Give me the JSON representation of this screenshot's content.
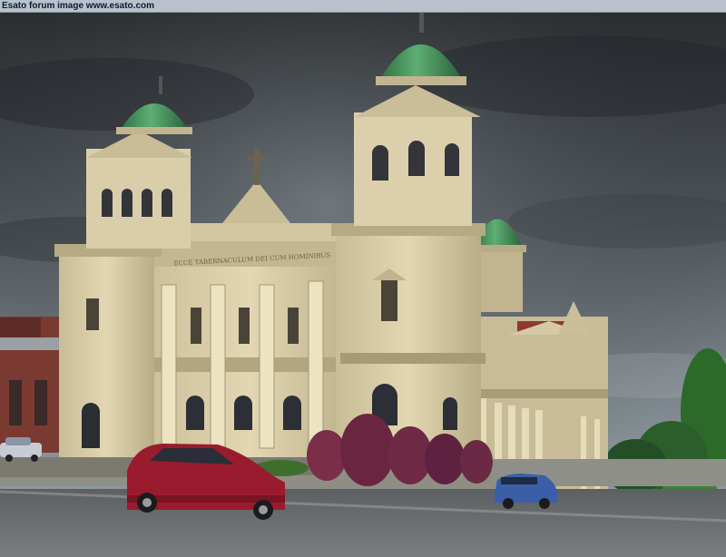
{
  "banner": {
    "text": "Esato forum image www.esato.com"
  },
  "scene": {
    "subject": "cathedral-photo",
    "frieze_inscription": "ECCE TABERNACULUM DEI CUM HOMINIBUS",
    "colors": {
      "sky_dark": "#2e3134",
      "sky_light": "#7d868c",
      "stone": "#d8cca8",
      "stone_shade": "#a89c7a",
      "dome_green": "#3f8a55",
      "car_red": "#9b1b2e",
      "car_blue": "#3a5fa8",
      "bush_purple": "#6a2a45",
      "road": "#6f7273",
      "tree_green": "#2e6a2e"
    }
  }
}
